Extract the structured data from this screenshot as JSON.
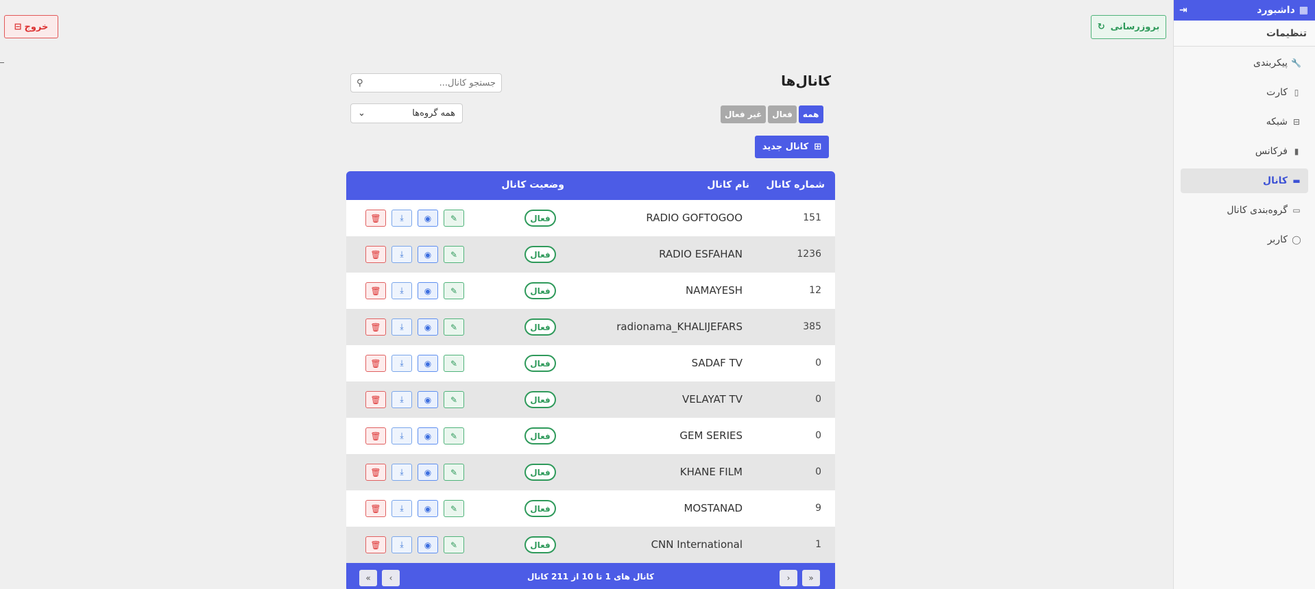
{
  "sidebar": {
    "dashboard_label": "داشبورد",
    "settings_label": "تنظیمات",
    "items": [
      {
        "label": "پیکربندی",
        "icon": "wrench-icon",
        "glyph": "🔧",
        "active": false
      },
      {
        "label": "کارت",
        "icon": "card-icon",
        "glyph": "▯",
        "active": false
      },
      {
        "label": "شبکه",
        "icon": "network-icon",
        "glyph": "⊟",
        "active": false
      },
      {
        "label": "فرکانس",
        "icon": "frequency-icon",
        "glyph": "▮",
        "active": false
      },
      {
        "label": "کانال",
        "icon": "channel-icon",
        "glyph": "▬",
        "active": true
      },
      {
        "label": "گروه‌بندی کانال",
        "icon": "group-icon",
        "glyph": "▭",
        "active": false
      },
      {
        "label": "کاربر",
        "icon": "user-icon",
        "glyph": "◯",
        "active": false
      }
    ]
  },
  "header": {
    "exit_label": "خروج",
    "refresh_label": "بروزرسانی"
  },
  "page": {
    "title": "کانال‌ها",
    "search_placeholder": "جستجو کانال...",
    "group_select_value": "همه گروه‌ها",
    "tabs": [
      {
        "label": "همه",
        "active": true
      },
      {
        "label": "فعال",
        "active": false
      },
      {
        "label": "غیر فعال",
        "active": false
      }
    ],
    "new_channel_label": "کانال جدید"
  },
  "table": {
    "columns": {
      "number": "شماره کانال",
      "name": "نام کانال",
      "status": "وضعیت کانال"
    },
    "rows": [
      {
        "number": "151",
        "name": "RADIO GOFTOGOO",
        "status": "فعال"
      },
      {
        "number": "1236",
        "name": "RADIO ESFAHAN",
        "status": "فعال"
      },
      {
        "number": "12",
        "name": "NAMAYESH",
        "status": "فعال"
      },
      {
        "number": "385",
        "name": "radionama_KHALIJEFARS",
        "status": "فعال"
      },
      {
        "number": "0",
        "name": "SADAF TV",
        "status": "فعال"
      },
      {
        "number": "0",
        "name": "VELAYAT TV",
        "status": "فعال"
      },
      {
        "number": "0",
        "name": "GEM SERIES",
        "status": "فعال"
      },
      {
        "number": "0",
        "name": "KHANE FILM",
        "status": "فعال"
      },
      {
        "number": "9",
        "name": "MOSTANAD",
        "status": "فعال"
      },
      {
        "number": "1",
        "name": "CNN International",
        "status": "فعال"
      }
    ],
    "footer_info": "کانال های 1 تا 10 از 211 کانال"
  },
  "colors": {
    "primary": "#4c5ce6",
    "success": "#2f9a5b",
    "danger": "#d33333"
  }
}
